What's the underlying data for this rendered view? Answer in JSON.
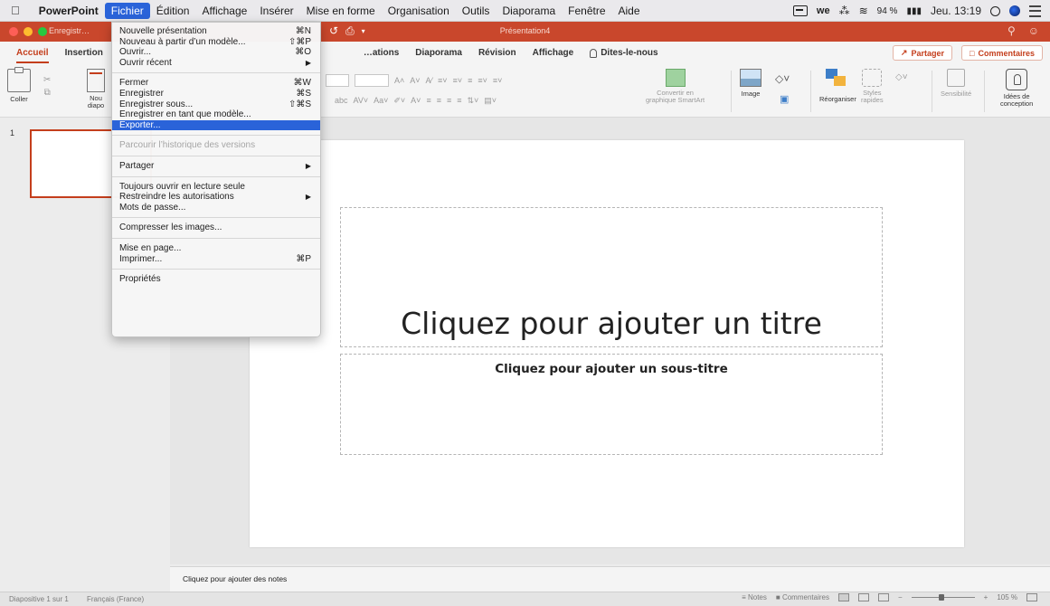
{
  "menubar": {
    "app": "PowerPoint",
    "items": [
      "Fichier",
      "Édition",
      "Affichage",
      "Insérer",
      "Mise en forme",
      "Organisation",
      "Outils",
      "Diaporama",
      "Fenêtre",
      "Aide"
    ],
    "status": {
      "network": "≋",
      "battery": "94 %",
      "battery_icon": "▮▮▮",
      "datetime": "Jeu. 13:19"
    }
  },
  "window": {
    "save_label": "Enregistr…",
    "title": "Présentation4"
  },
  "ribbon": {
    "tabs": [
      "Accueil",
      "Insertion"
    ],
    "tabs_right": [
      "…ations",
      "Diaporama",
      "Révision",
      "Affichage"
    ],
    "search": "Dites-le-nous",
    "share": "Partager",
    "comments": "Commentaires",
    "groups": {
      "paste": "Coller",
      "new_slide": "Nou\ndiapo",
      "smartart": "Convertir en\ngraphique SmartArt",
      "image": "Image",
      "arrange": "Réorganiser",
      "styles": "Styles\nrapides",
      "sensitivity": "Sensibilité",
      "ideas": "Idées de\nconception"
    }
  },
  "thumbs": {
    "number": "1"
  },
  "slide": {
    "title_placeholder": "Cliquez pour ajouter un titre",
    "subtitle_placeholder": "Cliquez pour ajouter un sous-titre"
  },
  "notes": {
    "placeholder": "Cliquez pour ajouter des notes"
  },
  "statusbar": {
    "slide": "Diapositive 1 sur 1",
    "language": "Français (France)",
    "notes": "Notes",
    "comments": "Commentaires",
    "zoom": "105 %"
  },
  "file_menu": {
    "groups": [
      [
        {
          "label": "Nouvelle présentation",
          "shortcut": "⌘N"
        },
        {
          "label": "Nouveau à partir d’un modèle...",
          "shortcut": "⇧⌘P"
        },
        {
          "label": "Ouvrir...",
          "shortcut": "⌘O"
        },
        {
          "label": "Ouvrir récent",
          "submenu": true
        }
      ],
      [
        {
          "label": "Fermer",
          "shortcut": "⌘W"
        },
        {
          "label": "Enregistrer",
          "shortcut": "⌘S"
        },
        {
          "label": "Enregistrer sous...",
          "shortcut": "⇧⌘S"
        },
        {
          "label": "Enregistrer en tant que modèle..."
        },
        {
          "label": "Exporter...",
          "highlighted": true
        }
      ],
      [
        {
          "label": "Parcourir l’historique des versions",
          "disabled": true
        }
      ],
      [
        {
          "label": "Partager",
          "submenu": true
        }
      ],
      [
        {
          "label": "Toujours ouvrir en lecture seule"
        },
        {
          "label": "Restreindre les autorisations",
          "submenu": true
        },
        {
          "label": "Mots de passe..."
        }
      ],
      [
        {
          "label": "Compresser les images..."
        }
      ],
      [
        {
          "label": "Mise en page..."
        },
        {
          "label": "Imprimer...",
          "shortcut": "⌘P"
        }
      ],
      [
        {
          "label": "Propriétés"
        }
      ]
    ]
  },
  "colors": {
    "accent": "#c43e1c",
    "titlebar": "#c9472c",
    "menu_highlight": "#2a63d9"
  }
}
